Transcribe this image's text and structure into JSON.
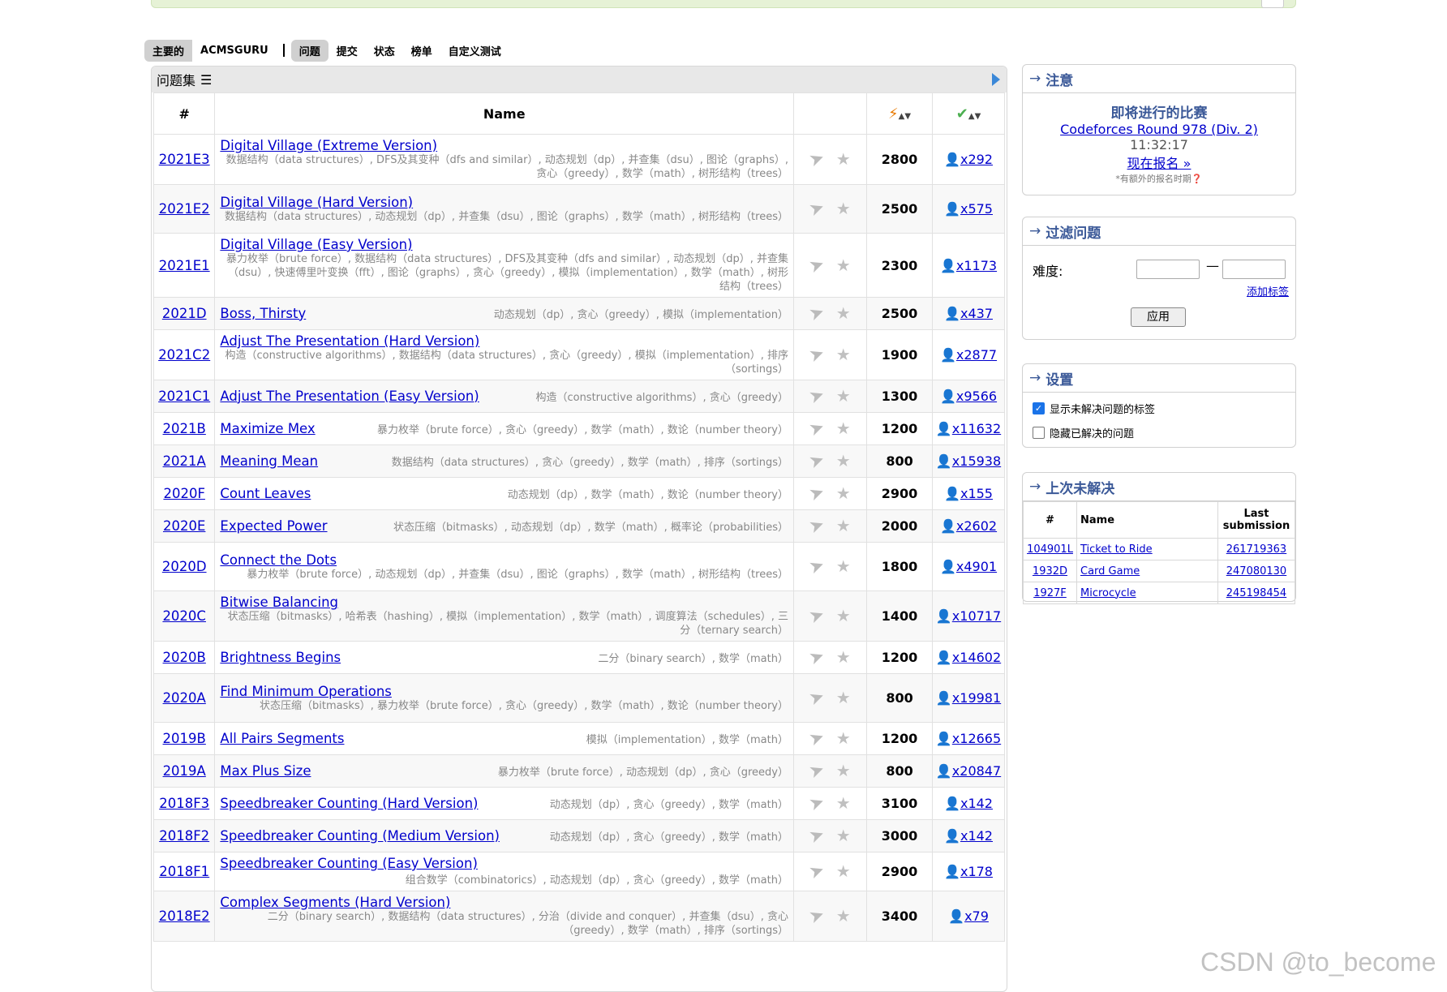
{
  "menu": {
    "left": [
      "主要的",
      "ACMSGURU"
    ],
    "right": [
      "问题",
      "提交",
      "状态",
      "榜单",
      "自定义测试"
    ]
  },
  "problemset": {
    "title": "问题集",
    "headers": {
      "id": "#",
      "name": "Name"
    },
    "problems": [
      {
        "id": "2021E3",
        "name": "Digital Village (Extreme Version)",
        "tags": "数据结构（data structures）, DFS及其变种（dfs and similar）, 动态规划（dp）, 并查集（dsu）, 图论（graphs）, 贪心（greedy）, 数学（math）, 树形结构（trees）",
        "difficulty": "2800",
        "solved": "x292"
      },
      {
        "id": "2021E2",
        "name": "Digital Village (Hard Version)",
        "tags": "数据结构（data structures）, 动态规划（dp）, 并查集（dsu）, 图论（graphs）, 数学（math）, 树形结构（trees）",
        "difficulty": "2500",
        "solved": "x575"
      },
      {
        "id": "2021E1",
        "name": "Digital Village (Easy Version)",
        "tags": "暴力枚举（brute force）, 数据结构（data structures）, DFS及其变种（dfs and similar）, 动态规划（dp）, 并查集（dsu）, 快速傅里叶变换（fft）, 图论（graphs）, 贪心（greedy）, 模拟（implementation）, 数学（math）, 树形结构（trees）",
        "difficulty": "2300",
        "solved": "x1173"
      },
      {
        "id": "2021D",
        "name": "Boss, Thirsty",
        "tags": "动态规划（dp）, 贪心（greedy）, 模拟（implementation）",
        "difficulty": "2500",
        "solved": "x437"
      },
      {
        "id": "2021C2",
        "name": "Adjust The Presentation (Hard Version)",
        "tags": "构造（constructive algorithms）, 数据结构（data structures）, 贪心（greedy）, 模拟（implementation）, 排序（sortings）",
        "difficulty": "1900",
        "solved": "x2877"
      },
      {
        "id": "2021C1",
        "name": "Adjust The Presentation (Easy Version)",
        "tags": "构造（constructive algorithms）, 贪心（greedy）",
        "difficulty": "1300",
        "solved": "x9566"
      },
      {
        "id": "2021B",
        "name": "Maximize Mex",
        "tags": "暴力枚举（brute force）, 贪心（greedy）, 数学（math）, 数论（number theory）",
        "difficulty": "1200",
        "solved": "x11632"
      },
      {
        "id": "2021A",
        "name": "Meaning Mean",
        "tags": "数据结构（data structures）, 贪心（greedy）, 数学（math）, 排序（sortings）",
        "difficulty": "800",
        "solved": "x15938"
      },
      {
        "id": "2020F",
        "name": "Count Leaves",
        "tags": "动态规划（dp）, 数学（math）, 数论（number theory）",
        "difficulty": "2900",
        "solved": "x155"
      },
      {
        "id": "2020E",
        "name": "Expected Power",
        "tags": "状态压缩（bitmasks）, 动态规划（dp）, 数学（math）, 概率论（probabilities）",
        "difficulty": "2000",
        "solved": "x2602"
      },
      {
        "id": "2020D",
        "name": "Connect the Dots",
        "tags": "暴力枚举（brute force）, 动态规划（dp）, 并查集（dsu）, 图论（graphs）, 数学（math）, 树形结构（trees）",
        "difficulty": "1800",
        "solved": "x4901"
      },
      {
        "id": "2020C",
        "name": "Bitwise Balancing",
        "tags": "状态压缩（bitmasks）, 哈希表（hashing）, 模拟（implementation）, 数学（math）, 调度算法（schedules）, 三分（ternary search）",
        "difficulty": "1400",
        "solved": "x10717"
      },
      {
        "id": "2020B",
        "name": "Brightness Begins",
        "tags": "二分（binary search）, 数学（math）",
        "difficulty": "1200",
        "solved": "x14602"
      },
      {
        "id": "2020A",
        "name": "Find Minimum Operations",
        "tags": "状态压缩（bitmasks）, 暴力枚举（brute force）, 贪心（greedy）, 数学（math）, 数论（number theory）",
        "difficulty": "800",
        "solved": "x19981"
      },
      {
        "id": "2019B",
        "name": "All Pairs Segments",
        "tags": "模拟（implementation）, 数学（math）",
        "difficulty": "1200",
        "solved": "x12665"
      },
      {
        "id": "2019A",
        "name": "Max Plus Size",
        "tags": "暴力枚举（brute force）, 动态规划（dp）, 贪心（greedy）",
        "difficulty": "800",
        "solved": "x20847"
      },
      {
        "id": "2018F3",
        "name": "Speedbreaker Counting (Hard Version)",
        "tags": "动态规划（dp）, 贪心（greedy）, 数学（math）",
        "difficulty": "3100",
        "solved": "x142"
      },
      {
        "id": "2018F2",
        "name": "Speedbreaker Counting (Medium Version)",
        "tags": "动态规划（dp）, 贪心（greedy）, 数学（math）",
        "difficulty": "3000",
        "solved": "x142"
      },
      {
        "id": "2018F1",
        "name": "Speedbreaker Counting (Easy Version)",
        "tags": "组合数学（combinatorics）, 动态规划（dp）, 贪心（greedy）, 数学（math）",
        "difficulty": "2900",
        "solved": "x178"
      },
      {
        "id": "2018E2",
        "name": "Complex Segments (Hard Version)",
        "tags": "二分（binary search）, 数据结构（data structures）, 分治（divide and conquer）, 并查集（dsu）, 贪心（greedy）, 数学（math）, 排序（sortings）",
        "difficulty": "3400",
        "solved": "x79"
      }
    ]
  },
  "notice": {
    "title": "注意",
    "heading": "即将进行的比赛",
    "contest": "Codeforces Round 978 (Div. 2)",
    "countdown": "11:32:17",
    "register": "现在报名 »",
    "note": "*有额外的报名时期"
  },
  "filter": {
    "title": "过滤问题",
    "difficulty_label": "难度:",
    "dash": "—",
    "add_tag": "添加标签",
    "apply": "应用"
  },
  "settings": {
    "title": "设置",
    "options": [
      {
        "label": "显示未解决问题的标签",
        "checked": true
      },
      {
        "label": "隐藏已解决的问题",
        "checked": false
      }
    ]
  },
  "last_unsolved": {
    "title": "上次未解决",
    "headers": {
      "id": "#",
      "name": "Name",
      "submission": "Last submission"
    },
    "rows": [
      {
        "id": "104901L",
        "name": "Ticket to Ride",
        "submission": "261719363"
      },
      {
        "id": "1932D",
        "name": "Card Game",
        "submission": "247080130"
      },
      {
        "id": "1927F",
        "name": "Microcycle",
        "submission": "245198454"
      }
    ]
  },
  "watermark": "CSDN @to_become",
  "colors": {
    "link": "#0000cc",
    "accent": "#3b5998",
    "tag": "#888888",
    "user": "#1a3da8"
  }
}
